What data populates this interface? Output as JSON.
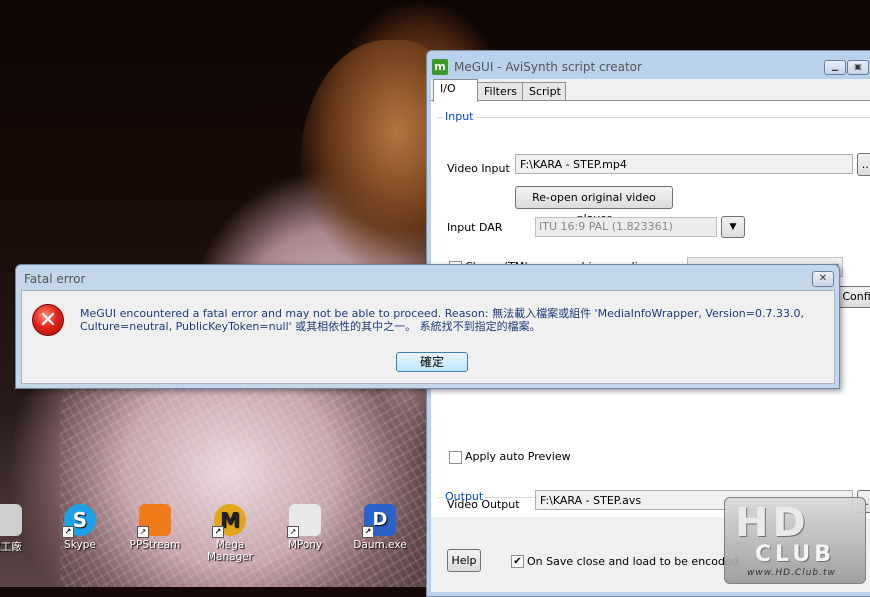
{
  "megui": {
    "title": "MeGUI - AviSynth script creator",
    "app_icon": "m",
    "tabs": [
      {
        "label": "I/O"
      },
      {
        "label": "Filters"
      },
      {
        "label": "Script"
      }
    ],
    "input_group": "Input",
    "video_input_label": "Video Input",
    "video_input_value": "F:\\KARA - STEP.mp4",
    "browse_label": "...",
    "reopen_button": "Re-open original video player",
    "input_dar_label": "Input DAR",
    "input_dar_value": "ITU 16:9 PAL (1.823361)",
    "clever_label": "Clever (TM) anamorphic encoding:",
    "config_button": "Config",
    "apply_auto_preview": "Apply auto Preview",
    "output_group": "Output",
    "video_output_label": "Video Output",
    "video_output_value": "F:\\KARA - STEP.avs",
    "help_button": "Help",
    "on_save_label": "On Save close and load to be encoded",
    "on_save_checked": true
  },
  "dialog": {
    "title": "Fatal error",
    "close_glyph": "✕",
    "message": "MeGUI encountered a fatal error and may not be able to proceed. Reason: 無法載入檔案或組件 'MediaInfoWrapper, Version=0.7.33.0, Culture=neutral, PublicKeyToken=null' 或其相依性的其中之一。 系統找不到指定的檔案。",
    "ok_button": "確定",
    "icon": "error-icon"
  },
  "desktop_icons": [
    {
      "label": "式工廠",
      "icon": "format-factory-icon",
      "color": "#cfcfcf"
    },
    {
      "label": "Skype",
      "icon": "skype-icon",
      "color": "#1ea0e6"
    },
    {
      "label": "PPStream",
      "icon": "ppstream-icon",
      "color": "#f07b19"
    },
    {
      "label": "Mega Manager",
      "icon": "mega-manager-icon",
      "color": "#e2a51c"
    },
    {
      "label": "MPony",
      "icon": "mpony-icon",
      "color": "#e8e8e8"
    },
    {
      "label": "Daum.exe",
      "icon": "daum-icon",
      "color": "#2a62c9"
    }
  ],
  "watermark": {
    "big": "HD",
    "club": "CLUB",
    "url": "www.HD.Club.tw"
  }
}
